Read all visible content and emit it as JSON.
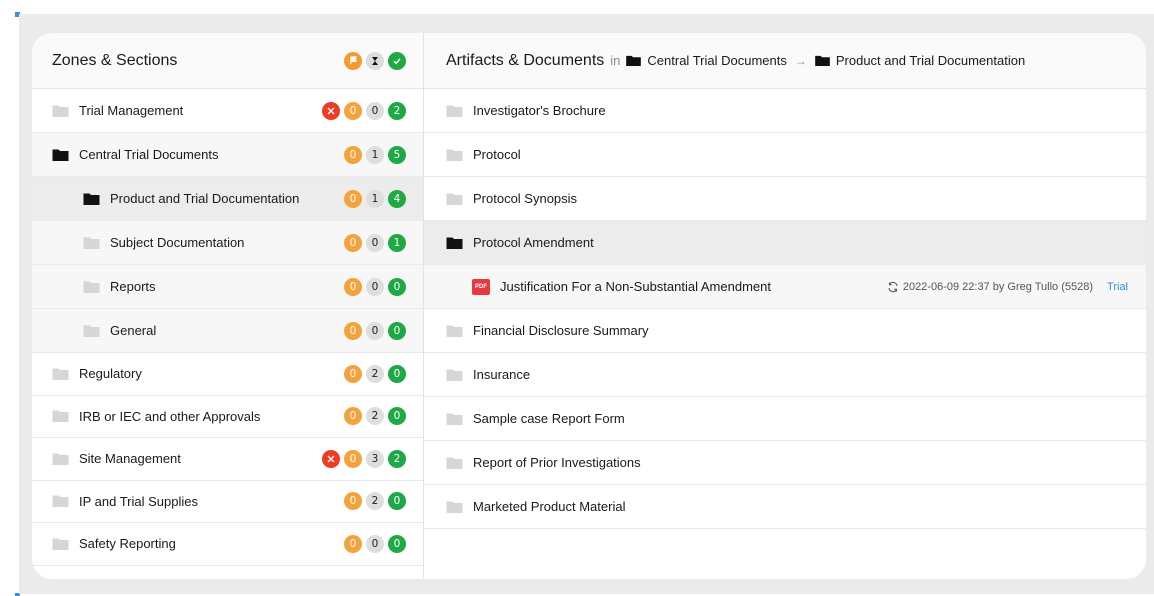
{
  "colors": {
    "accent": "#3d8fe0",
    "error": "#ef3b24",
    "pending": "#f6a23c",
    "neutral": "#dedede",
    "success": "#1fa846",
    "pdf": "#e8383d"
  },
  "left": {
    "title": "Zones & Sections",
    "legend": [
      "flag-icon",
      "hourglass-icon",
      "check-icon"
    ],
    "zones": [
      {
        "label": "Trial Management",
        "error": true,
        "counts": [
          "0",
          "0",
          "2"
        ]
      },
      {
        "label": "Central Trial Documents",
        "error": false,
        "counts": [
          "0",
          "1",
          "5"
        ]
      },
      {
        "label": "Product and Trial Documentation",
        "error": false,
        "counts": [
          "0",
          "1",
          "4"
        ]
      },
      {
        "label": "Subject Documentation",
        "error": false,
        "counts": [
          "0",
          "0",
          "1"
        ]
      },
      {
        "label": "Reports",
        "error": false,
        "counts": [
          "0",
          "0",
          "0"
        ]
      },
      {
        "label": "General",
        "error": false,
        "counts": [
          "0",
          "0",
          "0"
        ]
      },
      {
        "label": "Regulatory",
        "error": false,
        "counts": [
          "0",
          "2",
          "0"
        ]
      },
      {
        "label": "IRB or IEC and other Approvals",
        "error": false,
        "counts": [
          "0",
          "2",
          "0"
        ]
      },
      {
        "label": "Site Management",
        "error": true,
        "counts": [
          "0",
          "3",
          "2"
        ]
      },
      {
        "label": "IP and Trial Supplies",
        "error": false,
        "counts": [
          "0",
          "2",
          "0"
        ]
      },
      {
        "label": "Safety Reporting",
        "error": false,
        "counts": [
          "0",
          "0",
          "0"
        ]
      }
    ]
  },
  "right": {
    "title": "Artifacts & Documents",
    "in_label": "in",
    "crumb1": "Central Trial Documents",
    "crumb_arrow": "→",
    "crumb2": "Product and Trial Documentation",
    "artifacts": [
      "Investigator's Brochure",
      "Protocol",
      "Protocol Synopsis",
      "Protocol Amendment",
      "Financial Disclosure Summary",
      "Insurance",
      "Sample case Report Form",
      "Report of Prior Investigations",
      "Marketed Product Material"
    ],
    "document": {
      "badge": "PDF",
      "title": "Justification For a Non-Substantial Amendment",
      "meta": "2022-06-09 22:37 by Greg Tullo (5528)",
      "tag": "Trial"
    }
  }
}
